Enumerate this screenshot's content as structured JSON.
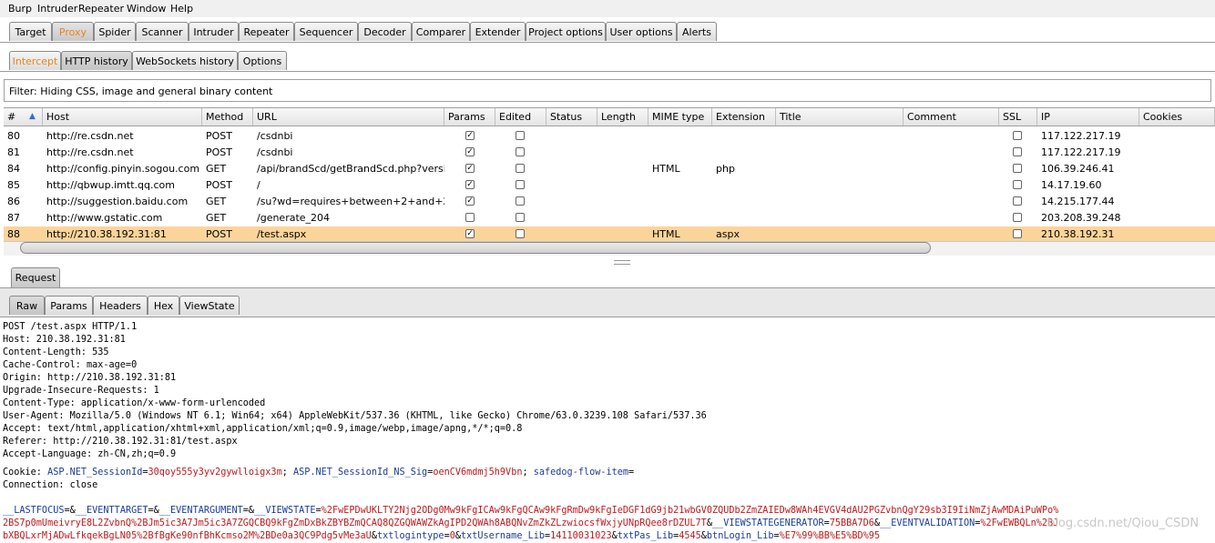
{
  "menubar": [
    "Burp",
    "Intruder",
    "Repeater",
    "Window",
    "Help"
  ],
  "main_tabs": [
    "Target",
    "Proxy",
    "Spider",
    "Scanner",
    "Intruder",
    "Repeater",
    "Sequencer",
    "Decoder",
    "Comparer",
    "Extender",
    "Project options",
    "User options",
    "Alerts"
  ],
  "proxy_tabs": [
    "Intercept",
    "HTTP history",
    "WebSockets history",
    "Options"
  ],
  "filter": "Filter:  Hiding CSS, image and general binary content",
  "columns": [
    "#",
    "Host",
    "Method",
    "URL",
    "Params",
    "Edited",
    "Status",
    "Length",
    "MIME type",
    "Extension",
    "Title",
    "Comment",
    "SSL",
    "IP",
    "Cookies"
  ],
  "rows": [
    {
      "num": "80",
      "host": "http://re.csdn.net",
      "method": "POST",
      "url": "/csdnbi",
      "params": true,
      "edited": false,
      "mime": "",
      "ext": "",
      "ssl": false,
      "ip": "117.122.217.19"
    },
    {
      "num": "81",
      "host": "http://re.csdn.net",
      "method": "POST",
      "url": "/csdnbi",
      "params": true,
      "edited": false,
      "mime": "",
      "ext": "",
      "ssl": false,
      "ip": "117.122.217.19"
    },
    {
      "num": "84",
      "host": "http://config.pinyin.sogou.com",
      "method": "GET",
      "url": "/api/brandScd/getBrandScd.php?versio...",
      "params": true,
      "edited": false,
      "mime": "HTML",
      "ext": "php",
      "ssl": false,
      "ip": "106.39.246.41"
    },
    {
      "num": "85",
      "host": "http://qbwup.imtt.qq.com",
      "method": "POST",
      "url": "/",
      "params": true,
      "edited": false,
      "mime": "",
      "ext": "",
      "ssl": false,
      "ip": "14.17.19.60"
    },
    {
      "num": "86",
      "host": "http://suggestion.baidu.com",
      "method": "GET",
      "url": "/su?wd=requires+between+2+and+20...",
      "params": true,
      "edited": false,
      "mime": "",
      "ext": "",
      "ssl": false,
      "ip": "14.215.177.44"
    },
    {
      "num": "87",
      "host": "http://www.gstatic.com",
      "method": "GET",
      "url": "/generate_204",
      "params": false,
      "edited": false,
      "mime": "",
      "ext": "",
      "ssl": false,
      "ip": "203.208.39.248"
    },
    {
      "num": "88",
      "host": "http://210.38.192.31:81",
      "method": "POST",
      "url": "/test.aspx",
      "params": true,
      "edited": false,
      "mime": "HTML",
      "ext": "aspx",
      "ssl": false,
      "ip": "210.38.192.31",
      "selected": true
    }
  ],
  "request_tab": "Request",
  "editor_tabs": [
    "Raw",
    "Params",
    "Headers",
    "Hex",
    "ViewState"
  ],
  "request_lines": [
    "POST /test.aspx HTTP/1.1",
    "Host: 210.38.192.31:81",
    "Content-Length: 535",
    "Cache-Control: max-age=0",
    "Origin: http://210.38.192.31:81",
    "Upgrade-Insecure-Requests: 1",
    "Content-Type: application/x-www-form-urlencoded",
    "User-Agent: Mozilla/5.0 (Windows NT 6.1; Win64; x64) AppleWebKit/537.36 (KHTML, like Gecko) Chrome/63.0.3239.108 Safari/537.36",
    "Accept: text/html,application/xhtml+xml,application/xml;q=0.9,image/webp,image/apng,*/*;q=0.8",
    "Referer: http://210.38.192.31:81/test.aspx",
    "Accept-Language: zh-CN,zh;q=0.9"
  ],
  "cookie": {
    "prefix": "Cookie: ",
    "parts": [
      {
        "t": "ASP.NET_SessionId",
        "c": "blue"
      },
      {
        "t": "=",
        "c": ""
      },
      {
        "t": "30qoy555y3yv2gywlloigx3m",
        "c": "red"
      },
      {
        "t": "; ",
        "c": ""
      },
      {
        "t": "ASP.NET_SessionId_NS_Sig",
        "c": "blue"
      },
      {
        "t": "=",
        "c": ""
      },
      {
        "t": "oenCV6mdmj5h9Vbn",
        "c": "red"
      },
      {
        "t": "; ",
        "c": ""
      },
      {
        "t": "safedog-flow-item",
        "c": "blue"
      },
      {
        "t": "=",
        "c": ""
      }
    ]
  },
  "connection_line": "Connection: close",
  "body_line1": [
    {
      "t": "__LASTFOCUS",
      "c": "blue"
    },
    {
      "t": "=&",
      "c": ""
    },
    {
      "t": "__EVENTTARGET",
      "c": "blue"
    },
    {
      "t": "=&",
      "c": ""
    },
    {
      "t": "__EVENTARGUMENT",
      "c": "blue"
    },
    {
      "t": "=&",
      "c": ""
    },
    {
      "t": "__VIEWSTATE",
      "c": "blue"
    },
    {
      "t": "=",
      "c": ""
    },
    {
      "t": "%2FwEPDwUKLTY2Njg2ODg0Mw9kFgICAw9kFgQCAw9kFgRmDw9kFgIeDGF1dG9jb21wbGV0ZQUDb2ZmZAIEDw8WAh4EVGV4dAU2PGZvbnQgY29sb3I9IiNmZjAwMDAiPuWPo%",
      "c": "red"
    }
  ],
  "body_line2": [
    {
      "t": "2BS7p0mUmeivryE8L2ZvbnQ%2BJm5ic3A7Jm5ic3A7ZGQCBQ9kFgZmDxBkZBYBZmQCAQ8QZGQWAWZkAgIPD2QWAh8ABQNvZmZkZLzwiocsfWxjyUNpRQee8rDZUL7T",
      "c": "red"
    },
    {
      "t": "&",
      "c": ""
    },
    {
      "t": "__VIEWSTATEGENERATOR",
      "c": "blue"
    },
    {
      "t": "=",
      "c": ""
    },
    {
      "t": "75BBA7D6",
      "c": "red"
    },
    {
      "t": "&",
      "c": ""
    },
    {
      "t": "__EVENTVALIDATION",
      "c": "blue"
    },
    {
      "t": "=",
      "c": ""
    },
    {
      "t": "%2FwEWBQLn%2BJ",
      "c": "red"
    }
  ],
  "body_line3": [
    {
      "t": "bXBQLxrMjADwLfkqekBgLN05%2BfBgKe90nfBhKcmso2M%2BDe0a3QC9Pdg5vMe3aU",
      "c": "red"
    },
    {
      "t": "&",
      "c": ""
    },
    {
      "t": "txtlogintype",
      "c": "blue"
    },
    {
      "t": "=",
      "c": ""
    },
    {
      "t": "0",
      "c": "red"
    },
    {
      "t": "&",
      "c": ""
    },
    {
      "t": "txtUsername_Lib",
      "c": "blue"
    },
    {
      "t": "=",
      "c": ""
    },
    {
      "t": "14110031023",
      "c": "red"
    },
    {
      "t": "&",
      "c": ""
    },
    {
      "t": "txtPas_Lib",
      "c": "blue"
    },
    {
      "t": "=",
      "c": ""
    },
    {
      "t": "4545",
      "c": "red"
    },
    {
      "t": "&",
      "c": ""
    },
    {
      "t": "btnLogin_Lib",
      "c": "blue"
    },
    {
      "t": "=",
      "c": ""
    },
    {
      "t": "%E7%99%BB%E5%BD%95",
      "c": "red"
    }
  ],
  "watermark": "blog.csdn.net/Qiou_CSDN"
}
